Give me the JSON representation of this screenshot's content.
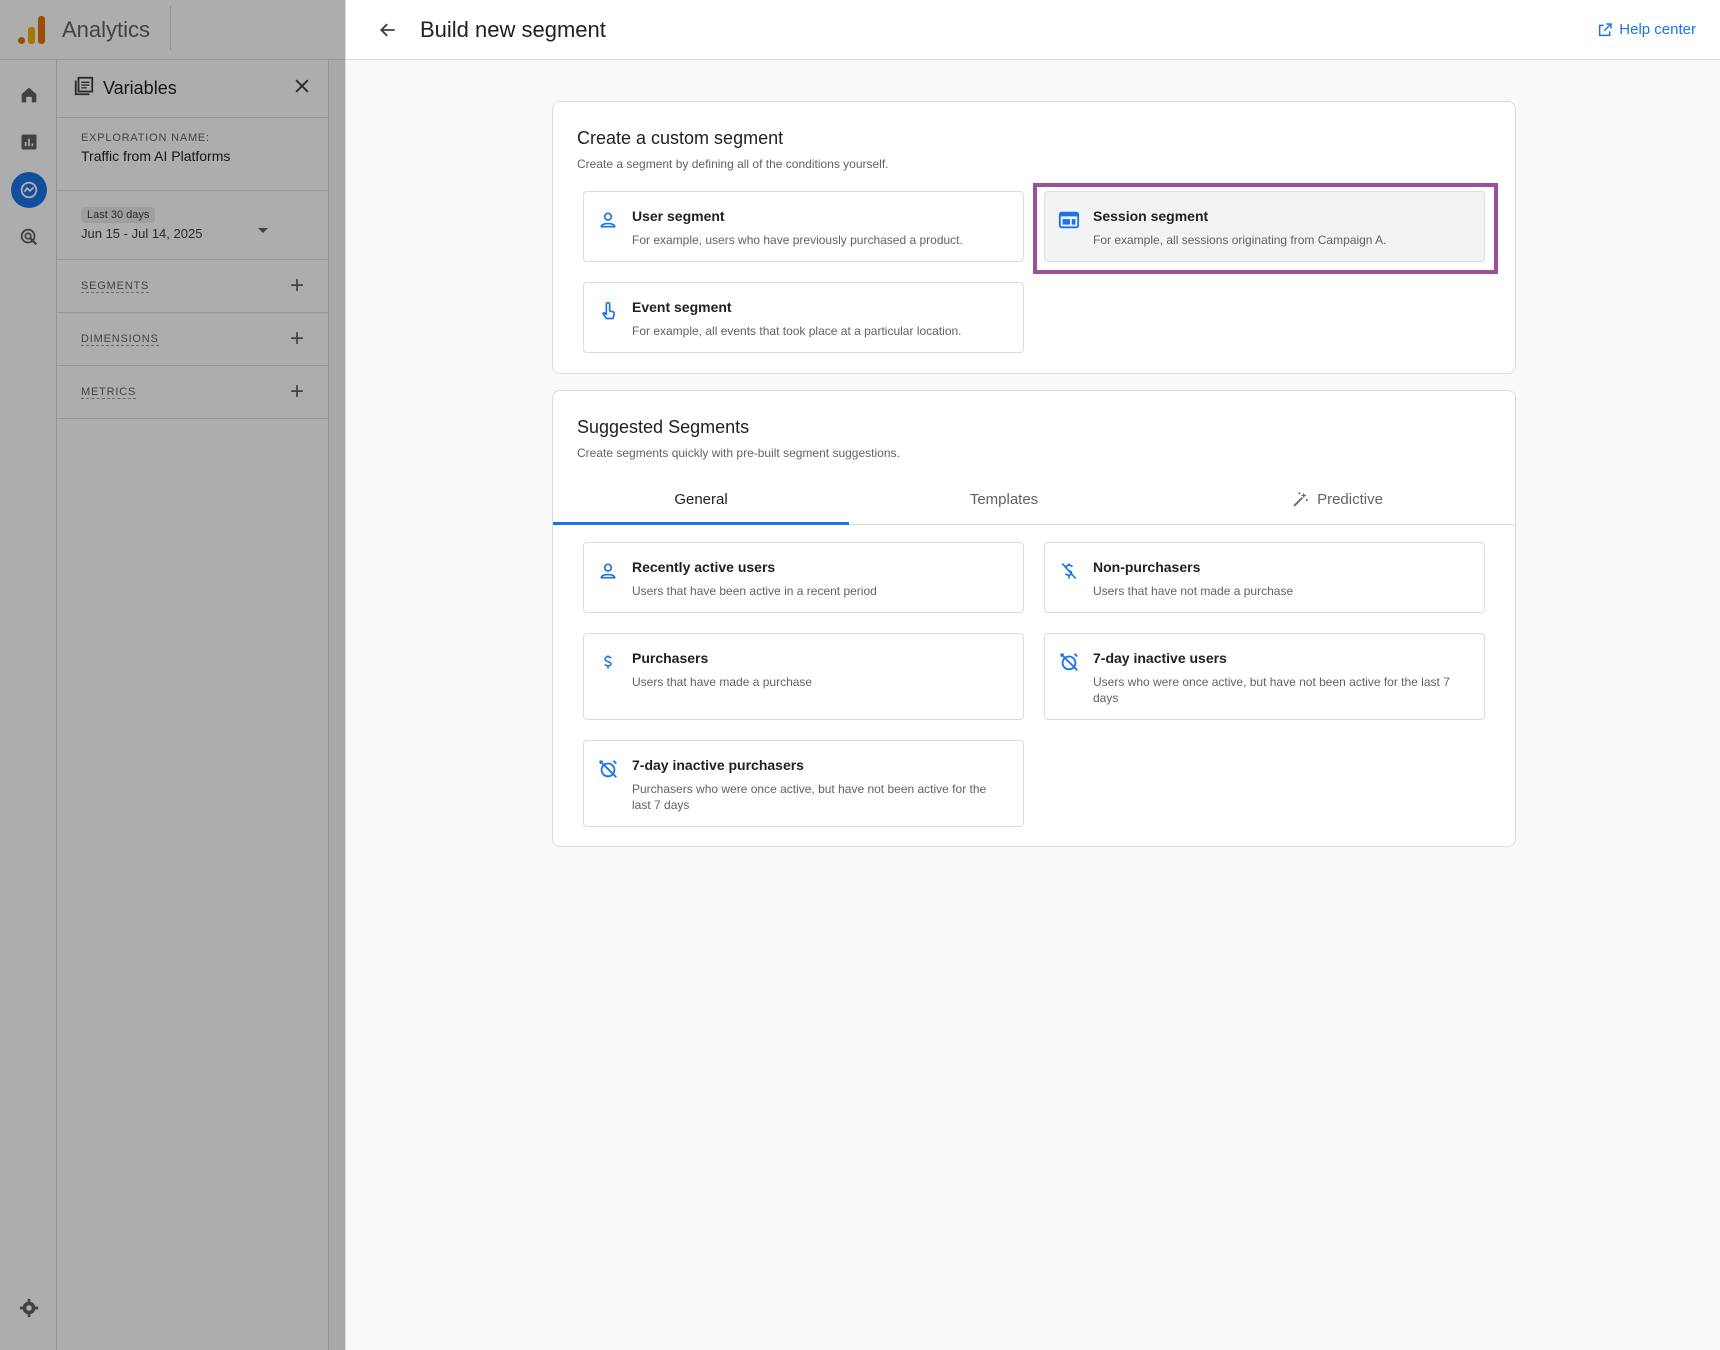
{
  "app": {
    "title": "Analytics"
  },
  "variables": {
    "title": "Variables",
    "exploration_label": "EXPLORATION NAME:",
    "exploration_name": "Traffic from AI Platforms",
    "date_chip": "Last 30 days",
    "date_range": "Jun 15 - Jul 14, 2025",
    "sections": [
      {
        "label": "SEGMENTS"
      },
      {
        "label": "DIMENSIONS"
      },
      {
        "label": "METRICS"
      }
    ]
  },
  "panel": {
    "title": "Build new segment",
    "help_label": "Help center"
  },
  "custom": {
    "title": "Create a custom segment",
    "subtitle": "Create a segment by defining all of the conditions yourself.",
    "options": [
      {
        "name": "User segment",
        "desc": "For example, users who have previously purchased a product.",
        "icon": "person-icon"
      },
      {
        "name": "Session segment",
        "desc": "For example, all sessions originating from Campaign A.",
        "icon": "session-icon"
      },
      {
        "name": "Event segment",
        "desc": "For example, all events that took place at a particular location.",
        "icon": "touch-icon"
      }
    ]
  },
  "suggested": {
    "title": "Suggested Segments",
    "subtitle": "Create segments quickly with pre-built segment suggestions.",
    "tabs": [
      {
        "label": "General",
        "active": true
      },
      {
        "label": "Templates",
        "active": false
      },
      {
        "label": "Predictive",
        "active": false
      }
    ],
    "options": [
      {
        "name": "Recently active users",
        "desc": "Users that have been active in a recent period",
        "icon": "person-icon"
      },
      {
        "name": "Non-purchasers",
        "desc": "Users that have not made a purchase",
        "icon": "money-off-icon"
      },
      {
        "name": "Purchasers",
        "desc": "Users that have made a purchase",
        "icon": "dollar-icon"
      },
      {
        "name": "7-day inactive users",
        "desc": "Users who were once active, but have not been active for the last 7 days",
        "icon": "alarm-off-icon"
      },
      {
        "name": "7-day inactive purchasers",
        "desc": "Purchasers who were once active, but have not been active for the last 7 days",
        "icon": "alarm-off-icon"
      }
    ]
  },
  "colors": {
    "accent": "#1a73e8",
    "highlight": "#9b4f9e"
  }
}
